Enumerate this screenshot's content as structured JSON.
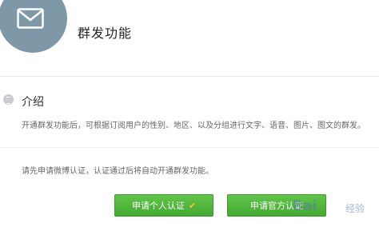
{
  "header": {
    "icon": "envelope-icon",
    "title": "群发功能"
  },
  "intro": {
    "icon": "info-circle-icon",
    "title": "介绍",
    "description": "开通群发功能后，可根据订阅用户的性别、地区、以及分组进行文字、语音、图片、图文的群发。"
  },
  "notice": "请先申请微博认证，认证通过后将自动开通群发功能。",
  "buttons": {
    "personal": "申请个人认证",
    "official": "申请官方认证"
  },
  "watermark": {
    "text": "Bai",
    "sub": "经验"
  },
  "colors": {
    "accent_green": "#4fb43b",
    "icon_circle": "#7f98a7"
  }
}
